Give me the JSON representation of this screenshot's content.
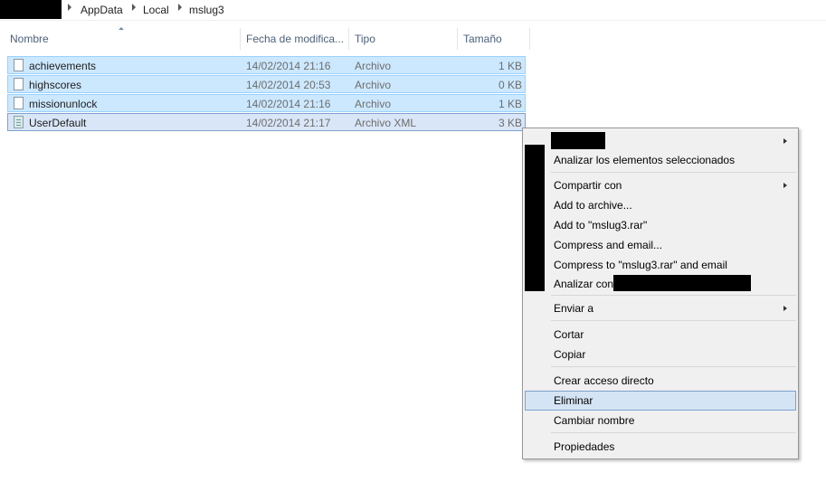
{
  "breadcrumb": {
    "items": [
      "AppData",
      "Local",
      "mslug3"
    ]
  },
  "columns": {
    "name": "Nombre",
    "date": "Fecha de modifica...",
    "type": "Tipo",
    "size": "Tamaño"
  },
  "files": [
    {
      "name": "achievements",
      "date": "14/02/2014 21:16",
      "type": "Archivo",
      "size": "1 KB",
      "icon": "file-icon"
    },
    {
      "name": "highscores",
      "date": "14/02/2014 20:53",
      "type": "Archivo",
      "size": "0 KB",
      "icon": "file-icon"
    },
    {
      "name": "missionunlock",
      "date": "14/02/2014 21:16",
      "type": "Archivo",
      "size": "1 KB",
      "icon": "file-icon"
    },
    {
      "name": "UserDefault",
      "date": "14/02/2014 21:17",
      "type": "Archivo XML",
      "size": "3 KB",
      "icon": "xml-file-icon"
    }
  ],
  "context_menu": {
    "analyze_selected": "Analizar los elementos seleccionados",
    "share_with": "Compartir con",
    "add_to_archive": "Add to archive...",
    "add_to_rar": "Add to \"mslug3.rar\"",
    "compress_email": "Compress and email...",
    "compress_rar_email": "Compress to \"mslug3.rar\" and email",
    "analyze_with": "Analizar con",
    "send_to": "Enviar a",
    "cut": "Cortar",
    "copy": "Copiar",
    "create_shortcut": "Crear acceso directo",
    "delete": "Eliminar",
    "rename": "Cambiar nombre",
    "properties": "Propiedades",
    "highlighted_item": "Eliminar"
  },
  "colors": {
    "selection_bg": "#cce8ff",
    "selection_border": "#99d1ff",
    "menu_bg": "#f0f0f0",
    "menu_highlight": "#d5e4f4",
    "header_text": "#4c607a"
  }
}
